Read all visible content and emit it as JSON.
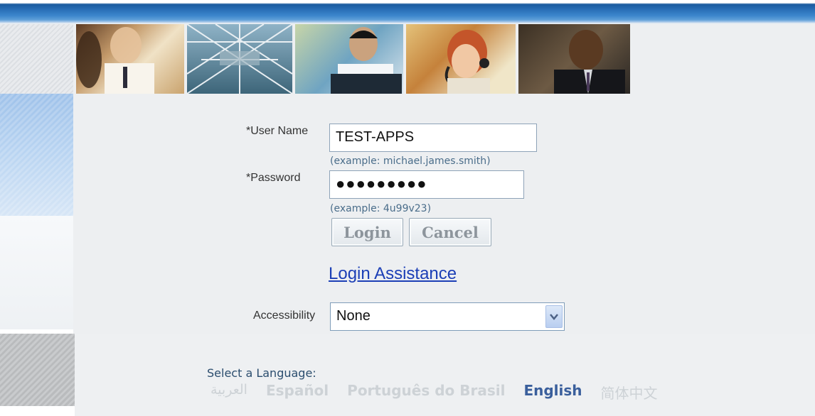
{
  "form": {
    "username": {
      "label": "*User Name",
      "value": "TEST-APPS",
      "hint": "(example: michael.james.smith)"
    },
    "password": {
      "label": "*Password",
      "value": "●●●●●●●●●",
      "hint": "(example: 4u99v23)"
    },
    "login_button": "Login",
    "cancel_button": "Cancel",
    "assistance_link": "Login Assistance",
    "accessibility": {
      "label": "Accessibility",
      "selected": "None"
    }
  },
  "language": {
    "label": "Select a Language:",
    "options": [
      {
        "label": "العربية",
        "active": false
      },
      {
        "label": "Español",
        "active": false
      },
      {
        "label": "Português do Brasil",
        "active": false
      },
      {
        "label": "English",
        "active": true
      },
      {
        "label": "简体中文",
        "active": false
      }
    ]
  },
  "colors": {
    "link": "#1c3fb6",
    "active_language": "#3a5f9c",
    "inactive_language": "#cdd2d6",
    "header_blue": "#2a70b8"
  },
  "icons": {
    "select_arrow": "chevron-down-icon"
  }
}
